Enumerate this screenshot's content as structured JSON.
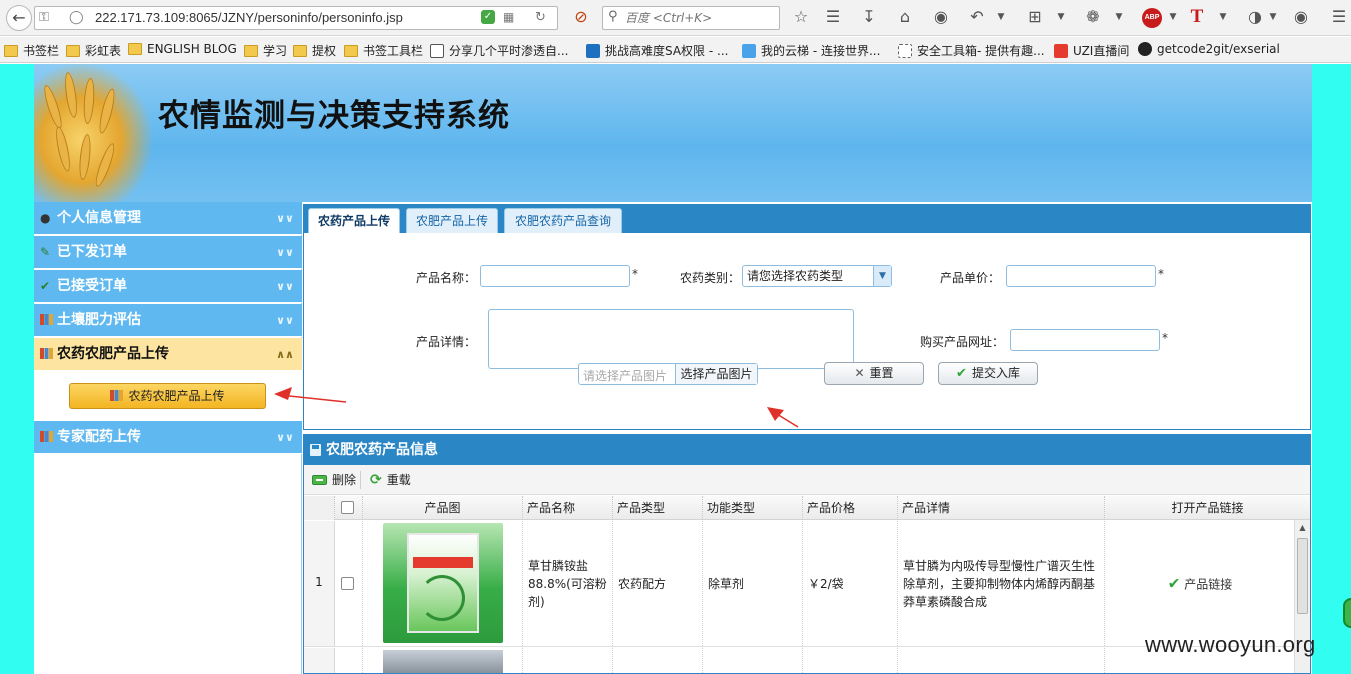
{
  "browser": {
    "url": "222.171.73.109:8065/JZNY/personinfo/personinfo.jsp",
    "search_placeholder": "百度 <Ctrl+K>"
  },
  "bookmarks": [
    "书签栏",
    "彩虹表",
    "ENGLISH BLOG",
    "学习",
    "提权",
    "书签工具栏",
    "分享几个平时渗透自...",
    "挑战高难度SA权限 - ...",
    "我的云梯 - 连接世界...",
    "安全工具箱- 提供有趣...",
    "UZI直播间",
    "getcode2git/exserial"
  ],
  "site": {
    "title": "农情监测与决策支持系统"
  },
  "sidebar": {
    "items": [
      {
        "label": "个人信息管理",
        "icon": "user-icon"
      },
      {
        "label": "已下发订单",
        "icon": "pencil-icon"
      },
      {
        "label": "已接受订单",
        "icon": "check-icon"
      },
      {
        "label": "土壤肥力评估",
        "icon": "bar-chart-icon"
      },
      {
        "label": "农药农肥产品上传",
        "icon": "bar-chart-icon",
        "active": true
      },
      {
        "label": "专家配药上传",
        "icon": "bar-chart-icon"
      }
    ],
    "sub_button": "农药农肥产品上传"
  },
  "tabs": [
    "农药产品上传",
    "农肥产品上传",
    "农肥农药产品查询"
  ],
  "form": {
    "name_label": "产品名称：",
    "category_label": "农药类别：",
    "category_value": "请您选择农药类型",
    "price_label": "产品单价：",
    "detail_label": "产品详情：",
    "url_label": "购买产品网址：",
    "required_mark": "*",
    "image_placeholder": "请选择产品图片",
    "choose_image": "选择产品图片",
    "reset": "重置",
    "submit": "提交入库"
  },
  "grid": {
    "title": "农肥农药产品信息",
    "toolbar": {
      "delete": "删除",
      "reload": "重载"
    },
    "columns": [
      "产品图",
      "产品名称",
      "产品类型",
      "功能类型",
      "产品价格",
      "产品详情",
      "打开产品链接"
    ],
    "rows": [
      {
        "num": "1",
        "name": "草甘膦铵盐88.8%(可溶粉剂)",
        "type": "农药配方",
        "function": "除草剂",
        "price": "￥2/袋",
        "detail": "草甘膦为内吸传导型慢性广谱灭生性除草剂，主要抑制物体内烯醇丙酮基莽草素磷酸合成",
        "link": "产品链接"
      }
    ]
  },
  "watermark": "www.wooyun.org",
  "colors": {
    "page_bg": "#31fdf1",
    "accent": "#2b86c6",
    "sidebar_item": "#60b8f0",
    "sidebar_active": "#fde5a1"
  }
}
